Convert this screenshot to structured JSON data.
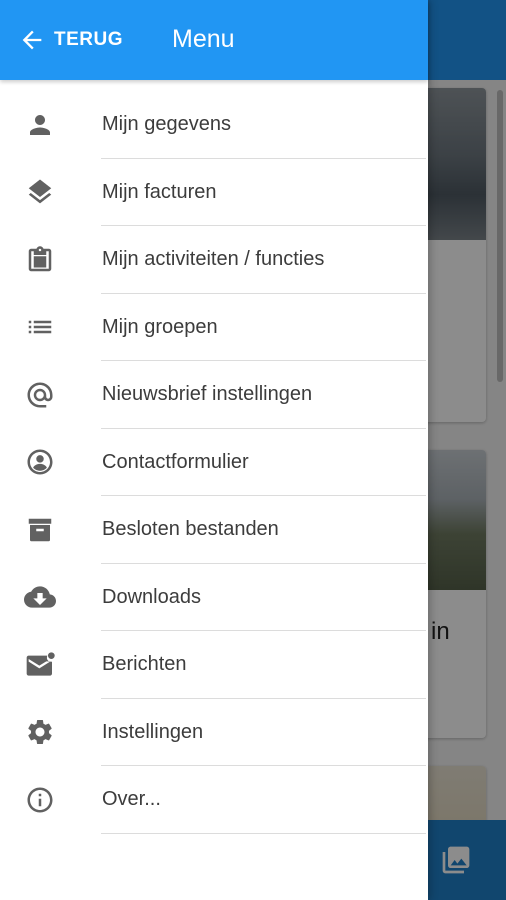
{
  "header": {
    "back_label": "TERUG",
    "title": "Menu"
  },
  "menu": {
    "items": [
      {
        "label": "Mijn gegevens",
        "icon": "person-icon"
      },
      {
        "label": "Mijn facturen",
        "icon": "layers-icon"
      },
      {
        "label": "Mijn activiteiten / functies",
        "icon": "clipboard-icon"
      },
      {
        "label": "Mijn groepen",
        "icon": "list-icon"
      },
      {
        "label": "Nieuwsbrief instellingen",
        "icon": "at-sign-icon"
      },
      {
        "label": "Contactformulier",
        "icon": "account-circle-icon"
      },
      {
        "label": "Besloten bestanden",
        "icon": "archive-icon"
      },
      {
        "label": "Downloads",
        "icon": "cloud-download-icon"
      },
      {
        "label": "Berichten",
        "icon": "mail-notification-icon"
      },
      {
        "label": "Instellingen",
        "icon": "gear-icon"
      },
      {
        "label": "Over...",
        "icon": "info-icon"
      }
    ]
  },
  "background": {
    "card2_title_fragment": "in"
  },
  "colors": {
    "primary": "#2196f3",
    "primary_dark": "#1f80c9",
    "icon": "#616161",
    "text": "#3c3c3c"
  }
}
